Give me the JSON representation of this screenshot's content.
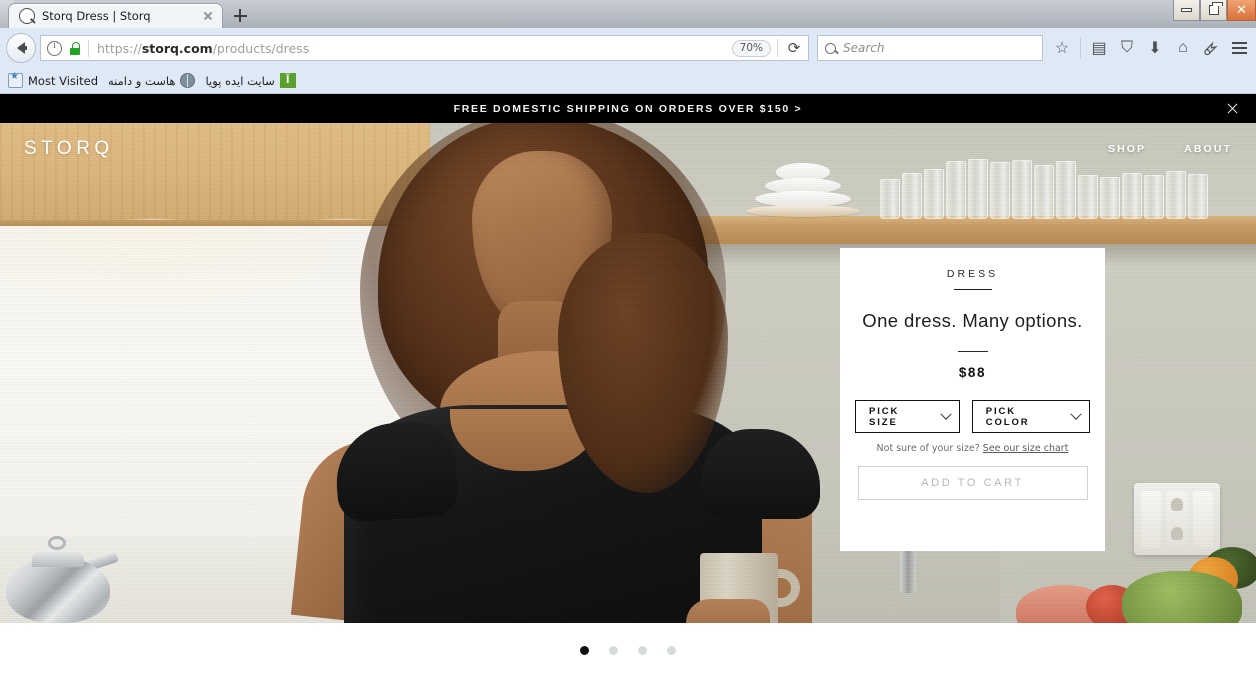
{
  "browser": {
    "tab": {
      "title": "Storq Dress | Storq",
      "favicon": "search-favicon",
      "close": "×"
    },
    "newtab_label": "+",
    "window_controls": {
      "minimize": "—",
      "restore": "❐",
      "close": "✕"
    },
    "nav": {
      "back_label": "Back",
      "identity_icon": "info-icon",
      "lock_icon": "lock-icon",
      "url_scheme": "https://",
      "url_host": "storq.com",
      "url_path": "/products/dress",
      "zoom_level": "70%",
      "reload_label": "⟳"
    },
    "search": {
      "placeholder": "Search",
      "icon": "search-icon"
    },
    "toolbar_icons": [
      {
        "name": "bookmark-star-icon",
        "glyph": "☆"
      },
      {
        "name": "library-icon",
        "glyph": "▤"
      },
      {
        "name": "pocket-icon",
        "glyph": "⛉"
      },
      {
        "name": "downloads-icon",
        "glyph": "⬇"
      },
      {
        "name": "home-icon",
        "glyph": "⌂"
      },
      {
        "name": "addon-fly-icon",
        "glyph": "🜸"
      }
    ],
    "bookmarks": [
      {
        "label": "Most Visited",
        "icon": "most-visited-icon"
      },
      {
        "label": "هاست و دامنه",
        "icon": "globe-icon"
      },
      {
        "label": "سایت ایده پویا",
        "icon": "green-site-icon"
      }
    ]
  },
  "promo": {
    "text": "FREE DOMESTIC SHIPPING ON ORDERS OVER $150 >",
    "close_label": "close-promo"
  },
  "site": {
    "logo": "STORQ",
    "nav": [
      {
        "label": "SHOP"
      },
      {
        "label": "ABOUT"
      }
    ]
  },
  "product": {
    "eyebrow": "DRESS",
    "headline": "One dress. Many options.",
    "price": "$88",
    "size_select": {
      "label": "PICK SIZE",
      "icon": "chevron-down-icon"
    },
    "color_select": {
      "label": "PICK COLOR",
      "icon": "chevron-down-icon"
    },
    "size_hint_prefix": "Not sure of your size? ",
    "size_hint_link": "See our size chart",
    "add_to_cart": "ADD TO CART"
  },
  "carousel": {
    "dots": [
      {
        "active": true
      },
      {
        "active": false
      },
      {
        "active": false
      },
      {
        "active": false
      }
    ]
  },
  "colors": {
    "promo_bg": "#000000",
    "accent_text": "#111111",
    "muted_text": "#b7b7b7",
    "lock_green": "#22a323",
    "browser_chrome": "#dfe9f5"
  }
}
